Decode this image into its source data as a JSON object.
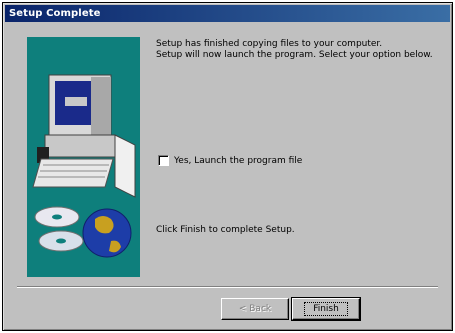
{
  "window": {
    "title": "Setup Complete"
  },
  "message": {
    "line1": "Setup has finished copying files to your computer.",
    "line2": "Setup will now launch the program. Select your option below."
  },
  "option": {
    "label": "Yes, Launch the program file",
    "checked": false
  },
  "hint": "Click Finish to complete Setup.",
  "buttons": {
    "back": "< Back",
    "finish": "Finish"
  },
  "colors": {
    "titlebar_start": "#0a246a",
    "titlebar_end": "#3a6ea5",
    "dialog_face": "#c0c0c0",
    "illustration_bg": "#0e7f7c"
  },
  "icons": {
    "illustration": "computer-with-cds-and-globe-illustration"
  }
}
